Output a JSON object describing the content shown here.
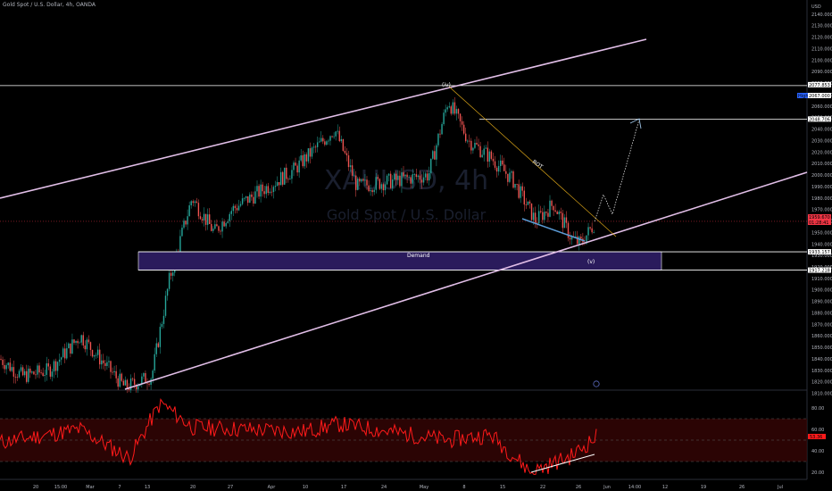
{
  "header": {
    "symbol_title": "Gold Spot / U.S. Dollar, 4h, OANDA"
  },
  "watermark": {
    "ticker": "XAUUSD, 4h",
    "name": "Gold Spot / U.S. Dollar"
  },
  "price_axis": {
    "currency": "USD",
    "ticks": [
      "2140.000",
      "2130.000",
      "2120.000",
      "2110.000",
      "2100.000",
      "2090.000",
      "2080.000",
      "2070.000",
      "2060.000",
      "2050.000",
      "2040.000",
      "2030.000",
      "2020.000",
      "2010.000",
      "2000.000",
      "1990.000",
      "1980.000",
      "1970.000",
      "1960.000",
      "1950.000",
      "1940.000",
      "1930.000",
      "1920.000",
      "1910.000",
      "1900.000",
      "1890.000",
      "1880.000",
      "1870.000",
      "1860.000",
      "1850.000",
      "1840.000",
      "1830.000",
      "1820.000",
      "1810.000"
    ],
    "tags": [
      {
        "label": "2077.853",
        "color": "#ffffff"
      },
      {
        "label": "High",
        "color": "#2962ff"
      },
      {
        "label": "2067.000",
        "color": "#ffffff"
      },
      {
        "label": "2048.706",
        "color": "#ffffff"
      },
      {
        "label": "1959.670",
        "color": "#f23645"
      },
      {
        "label": "01:28:41",
        "color": "#f23645"
      },
      {
        "label": "1933.157",
        "color": "#ffffff"
      },
      {
        "label": "1917.218",
        "color": "#ffffff"
      }
    ]
  },
  "rsi_axis": {
    "ticks": [
      "80.00",
      "60.00",
      "40.00",
      "20.00"
    ],
    "current": "53.36"
  },
  "time_axis": {
    "ticks": [
      "20",
      "15:00",
      "Mar",
      "7",
      "13",
      "20",
      "27",
      "Apr",
      "10",
      "17",
      "24",
      "May",
      "8",
      "15",
      "22",
      "26",
      "Jun",
      "14:00",
      "12",
      "19",
      "26",
      "Jul"
    ]
  },
  "annotations": {
    "wave_iv": "(iv)",
    "wave_v": "(v)",
    "zone": "Demand",
    "trendline": "ROT"
  },
  "colors": {
    "up": "#26a69a",
    "down": "#ef5350",
    "channel": "#e1bee7",
    "rsi": "#ff1a1a",
    "zone": "#2a1b5c"
  },
  "chart_data": {
    "type": "candlestick",
    "title": "Gold Spot / U.S. Dollar, 4h, OANDA",
    "ylim": [
      1805,
      2150
    ],
    "key_levels": [
      2077.853,
      2067.0,
      2048.706,
      1959.67,
      1933.157,
      1917.218
    ],
    "demand_zone": [
      1917.218,
      1933.157
    ],
    "price_path": {
      "x": [
        "Feb 20",
        "Feb 24",
        "Feb 28",
        "Mar 3",
        "Mar 8",
        "Mar 13",
        "Mar 16",
        "Mar 20",
        "Mar 24",
        "Mar 27",
        "Apr 4",
        "Apr 10",
        "Apr 13",
        "Apr 17",
        "Apr 24",
        "May 1",
        "May 4",
        "May 8",
        "May 12",
        "May 15",
        "May 19",
        "May 22",
        "May 24",
        "May 26",
        "May 28"
      ],
      "y": [
        1840,
        1825,
        1830,
        1860,
        1815,
        1825,
        1910,
        1980,
        1950,
        1970,
        1990,
        2005,
        2040,
        1990,
        1995,
        2000,
        2065,
        2030,
        2015,
        1995,
        1960,
        1975,
        1945,
        1940,
        1960
      ]
    },
    "rsi": {
      "ylim": [
        15,
        90
      ],
      "levels": [
        70,
        30
      ],
      "x": [
        "Feb 20",
        "Mar 3",
        "Mar 8",
        "Mar 13",
        "Mar 20",
        "Apr 10",
        "Apr 17",
        "May 4",
        "May 12",
        "May 19",
        "May 24",
        "May 28"
      ],
      "y": [
        48,
        60,
        33,
        85,
        62,
        58,
        65,
        50,
        55,
        20,
        35,
        53
      ]
    }
  }
}
